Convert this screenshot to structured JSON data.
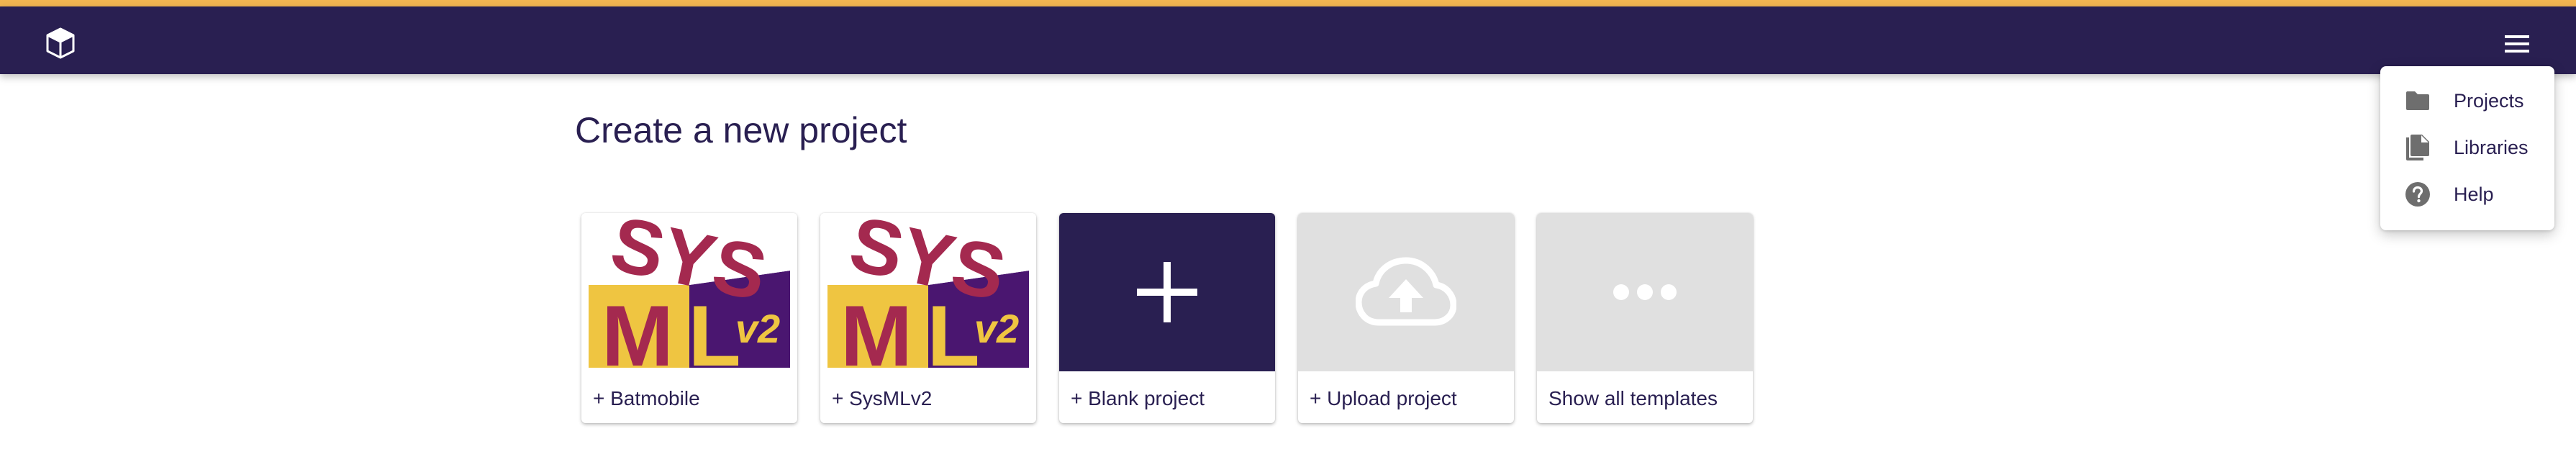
{
  "header": {
    "logo_icon": "cube-icon",
    "menu_icon": "hamburger-menu-icon",
    "accent_color": "#f2b551",
    "bar_color": "#291f51"
  },
  "main": {
    "title": "Create a new project",
    "cards": [
      {
        "label": "+ Batmobile",
        "image": "sysml-v2-logo"
      },
      {
        "label": "+ SysMLv2",
        "image": "sysml-v2-logo"
      },
      {
        "label": "+ Blank project",
        "icon": "plus-icon"
      },
      {
        "label": "+ Upload project",
        "icon": "cloud-upload-icon"
      },
      {
        "label": "Show all templates",
        "icon": "more-horizontal-icon"
      }
    ],
    "logo_text_top": "SYS",
    "logo_text_m": "M",
    "logo_text_l": "L",
    "logo_text_v2": "v2"
  },
  "menu": {
    "items": [
      {
        "label": "Projects",
        "icon": "folder-icon"
      },
      {
        "label": "Libraries",
        "icon": "library-icon"
      },
      {
        "label": "Help",
        "icon": "help-icon"
      }
    ]
  }
}
